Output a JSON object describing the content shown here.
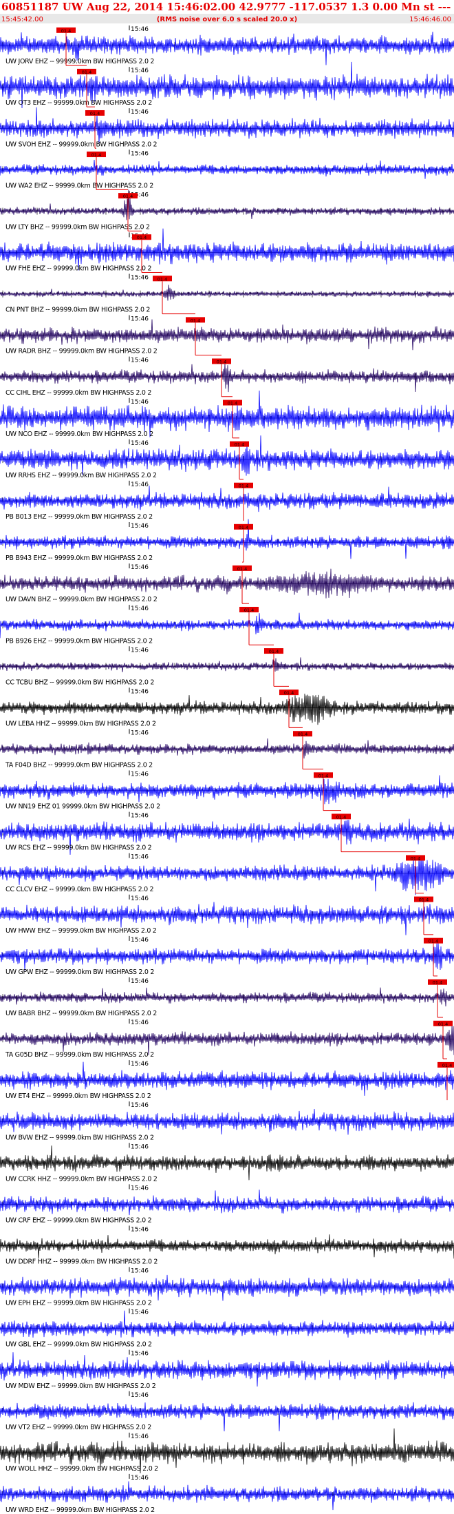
{
  "header": {
    "title": "60851187 UW Aug 22, 2014 15:46:02.00   42.9777 -117.0537  1.3 0.00 Mn st --- -- --  -1",
    "left_time": "15:45:42.00",
    "subtitle": "(RMS noise over 6.0 s scaled 20.0 x)",
    "right_time": "15:46:46.00"
  },
  "colors": {
    "header_red": "#e60000",
    "subheader_bg": "#e8e8e8",
    "blue": "#0000ff",
    "dark": "#200060",
    "black": "#000000",
    "pick_red": "#e60000",
    "axis": "#000000"
  },
  "chart_data": {
    "type": "seismogram",
    "time_start": "15:45:42.00",
    "time_end": "15:46:46.00",
    "minute_label": "15:46",
    "pick_label": "01.4",
    "traces": [
      {
        "label": "UW JORV EHZ -- 99999.0km BW  HIGHPASS  2.0  2",
        "color": "blue",
        "pick": 24.0,
        "amp": 0.35,
        "event_start": 26,
        "event_end": 32,
        "event_amp": 0.9
      },
      {
        "label": "UW OT3 EHZ -- 99999.0km BW  HIGHPASS  2.0  2",
        "color": "blue",
        "pick": 31.5,
        "amp": 0.45,
        "event_start": 31,
        "event_end": 37,
        "event_amp": 0.9
      },
      {
        "label": "UW SVOH EHZ -- 99999.0km BW  HIGHPASS  2.0  2",
        "color": "blue",
        "pick": 34.5,
        "amp": 0.35,
        "event_start": 34,
        "event_end": 40,
        "event_amp": 1.0
      },
      {
        "label": "UW WA2 EHZ -- 99999.0km BW  HIGHPASS  2.0  2",
        "color": "blue",
        "pick": 35.0,
        "amp": 0.2,
        "event_start": 35,
        "event_end": 40,
        "event_amp": 0.4
      },
      {
        "label": "UW LTY BHZ -- 99999.0km BW  HIGHPASS  2.0  2",
        "color": "dark",
        "pick": 46.5,
        "amp": 0.15,
        "event_start": 44,
        "event_end": 50,
        "event_amp": 0.9
      },
      {
        "label": "UW FHE EHZ -- 99999.0km BW  HIGHPASS  2.0  2",
        "color": "blue",
        "pick": 51.5,
        "amp": 0.4,
        "event_start": 48,
        "event_end": 55,
        "event_amp": 0.6
      },
      {
        "label": "CN PNT BHZ -- 99999.0km BW  HIGHPASS  2.0  2",
        "color": "dark",
        "pick": 59.0,
        "amp": 0.1,
        "event_start": 59,
        "event_end": 65,
        "event_amp": 0.6
      },
      {
        "label": "UW RADR BHZ -- 99999.0km BW  HIGHPASS  2.0  2",
        "color": "dark",
        "pick": 71.0,
        "amp": 0.3,
        "event_start": 70,
        "event_end": 76,
        "event_amp": 0.4
      },
      {
        "label": "CC CIHL EHZ -- 99999.0km BW  HIGHPASS  2.0  2",
        "color": "dark",
        "pick": 80.5,
        "amp": 0.25,
        "event_start": 80,
        "event_end": 86,
        "event_amp": 1.0
      },
      {
        "label": "UW NCO EHZ -- 99999.0km BW  HIGHPASS  2.0  2",
        "color": "blue",
        "pick": 84.5,
        "amp": 0.45,
        "event_start": 84,
        "event_end": 90,
        "event_amp": 1.0
      },
      {
        "label": "UW RRHS EHZ -- 99999.0km BW  HIGHPASS  2.0  2",
        "color": "blue",
        "pick": 87.0,
        "amp": 0.4,
        "event_start": 87,
        "event_end": 93,
        "event_amp": 1.0
      },
      {
        "label": "PB B013 EHZ -- 99999.0km BW  HIGHPASS  2.0  2",
        "color": "blue",
        "pick": 88.5,
        "amp": 0.3,
        "event_start": 88,
        "event_end": 93,
        "event_amp": 0.5
      },
      {
        "label": "PB B943 EHZ -- 99999.0km BW  HIGHPASS  2.0  2",
        "color": "blue",
        "pick": 88.5,
        "amp": 0.25,
        "event_start": 88,
        "event_end": 93,
        "event_amp": 0.6
      },
      {
        "label": "UW DAVN BHZ -- 99999.0km BW  HIGHPASS  2.0  2",
        "color": "dark",
        "pick": 88.0,
        "amp": 0.3,
        "event_start": 88,
        "event_end": 160,
        "event_amp": 0.8
      },
      {
        "label": "PB B926 EHZ -- 99999.0km BW  HIGHPASS  2.0  2",
        "color": "blue",
        "pick": 90.5,
        "amp": 0.2,
        "event_start": 92,
        "event_end": 97,
        "event_amp": 0.7
      },
      {
        "label": "CC TCBU BHZ -- 99999.0km BW  HIGHPASS  2.0  2",
        "color": "dark",
        "pick": 99.5,
        "amp": 0.15,
        "event_start": 98,
        "event_end": 104,
        "event_amp": 0.6
      },
      {
        "label": "UW LEBA HHZ -- 99999.0km BW  HIGHPASS  2.0  2",
        "color": "black",
        "pick": 105.0,
        "amp": 0.25,
        "event_start": 100,
        "event_end": 130,
        "event_amp": 1.0
      },
      {
        "label": "TA F04D BHZ -- 99999.0km BW  HIGHPASS  2.0  2",
        "color": "dark",
        "pick": 110.0,
        "amp": 0.2,
        "event_start": 109,
        "event_end": 114,
        "event_amp": 0.5
      },
      {
        "label": "UW NN19 EHZ 01 99999.0km BW  HIGHPASS  2.0  2",
        "color": "blue",
        "pick": 117.5,
        "amp": 0.3,
        "event_start": 114,
        "event_end": 128,
        "event_amp": 0.9
      },
      {
        "label": "UW RCS EHZ -- 99999.0km BW  HIGHPASS  2.0  2",
        "color": "blue",
        "pick": 124.0,
        "amp": 0.35,
        "event_start": 124,
        "event_end": 130,
        "event_amp": 1.0
      },
      {
        "label": "CC CLCV EHZ -- 99999.0km BW  HIGHPASS  2.0  2",
        "color": "blue",
        "pick": 151.0,
        "amp": 0.3,
        "event_start": 140,
        "event_end": 170,
        "event_amp": 1.2
      },
      {
        "label": "UW HWW EHZ -- 99999.0km BW  HIGHPASS  2.0  2",
        "color": "blue",
        "pick": 154.0,
        "amp": 0.35,
        "event_start": 158,
        "event_end": 164,
        "event_amp": 0.7
      },
      {
        "label": "UW GPW EHZ -- 99999.0km BW  HIGHPASS  2.0  2",
        "color": "blue",
        "pick": 157.5,
        "amp": 0.3,
        "event_start": 156,
        "event_end": 163,
        "event_amp": 1.0
      },
      {
        "label": "UW BABR BHZ -- 99999.0km BW  HIGHPASS  2.0  2",
        "color": "dark",
        "pick": 159.0,
        "amp": 0.2,
        "event_start": 158,
        "event_end": 166,
        "event_amp": 0.5
      },
      {
        "label": "TA G05D BHZ -- 99999.0km BW  HIGHPASS  2.0  2",
        "color": "dark",
        "pick": 161.0,
        "amp": 0.25,
        "event_start": 161,
        "event_end": 170,
        "event_amp": 0.9
      },
      {
        "label": "UW ET4 EHZ -- 99999.0km BW  HIGHPASS  2.0  2",
        "color": "blue",
        "pick": 162.5,
        "amp": 0.35,
        "event_start": 162,
        "event_end": 170,
        "event_amp": 0.7
      },
      {
        "label": "UW BVW EHZ -- 99999.0km BW  HIGHPASS  2.0  2",
        "color": "blue",
        "pick": null,
        "amp": 0.35,
        "event_start": null,
        "event_end": null,
        "event_amp": 0
      },
      {
        "label": "UW CCRK HHZ -- 99999.0km BW  HIGHPASS  2.0  2",
        "color": "black",
        "pick": null,
        "amp": 0.3,
        "event_start": null,
        "event_end": null,
        "event_amp": 0
      },
      {
        "label": "UW CRF EHZ -- 99999.0km BW  HIGHPASS  2.0  2",
        "color": "blue",
        "pick": null,
        "amp": 0.3,
        "event_start": null,
        "event_end": null,
        "event_amp": 0
      },
      {
        "label": "UW DDRF HHZ -- 99999.0km BW  HIGHPASS  2.0  2",
        "color": "black",
        "pick": null,
        "amp": 0.25,
        "event_start": null,
        "event_end": null,
        "event_amp": 0
      },
      {
        "label": "UW EPH EHZ -- 99999.0km BW  HIGHPASS  2.0  2",
        "color": "blue",
        "pick": null,
        "amp": 0.35,
        "event_start": null,
        "event_end": null,
        "event_amp": 0
      },
      {
        "label": "UW GBL EHZ -- 99999.0km BW  HIGHPASS  2.0  2",
        "color": "blue",
        "pick": null,
        "amp": 0.3,
        "event_start": null,
        "event_end": null,
        "event_amp": 0
      },
      {
        "label": "UW MDW EHZ -- 99999.0km BW  HIGHPASS  2.0  2",
        "color": "blue",
        "pick": null,
        "amp": 0.35,
        "event_start": null,
        "event_end": null,
        "event_amp": 0
      },
      {
        "label": "UW VT2 EHZ -- 99999.0km BW  HIGHPASS  2.0  2",
        "color": "blue",
        "pick": null,
        "amp": 0.3,
        "event_start": null,
        "event_end": null,
        "event_amp": 0
      },
      {
        "label": "UW WOLL HHZ -- 99999.0km BW  HIGHPASS  2.0  2",
        "color": "black",
        "pick": null,
        "amp": 0.4,
        "event_start": null,
        "event_end": null,
        "event_amp": 0
      },
      {
        "label": "UW WRD EHZ -- 99999.0km BW  HIGHPASS  2.0  2",
        "color": "blue",
        "pick": null,
        "amp": 0.3,
        "event_start": null,
        "event_end": null,
        "event_amp": 0
      }
    ]
  }
}
